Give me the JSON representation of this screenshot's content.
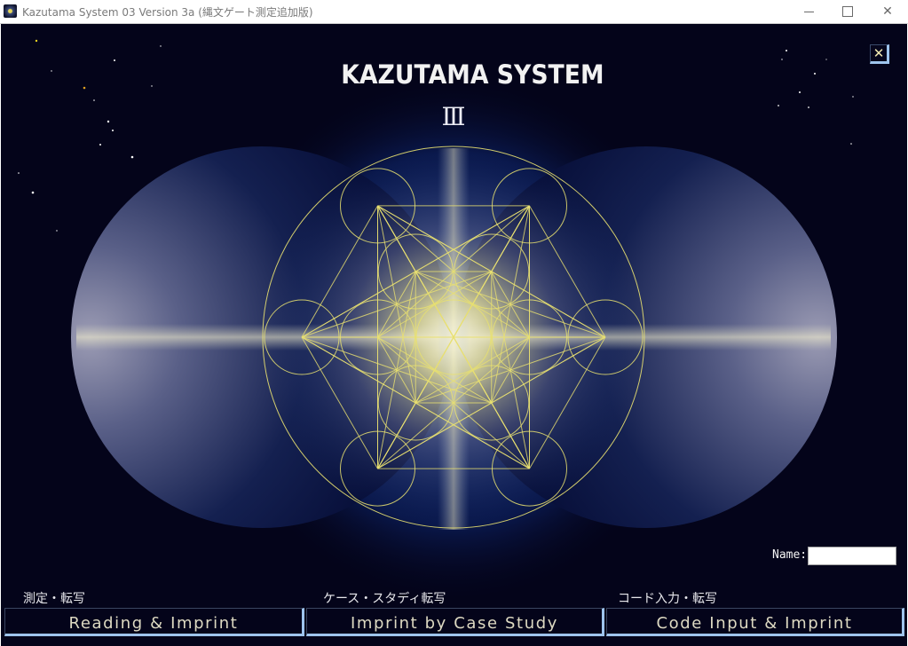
{
  "window": {
    "title": "Kazutama System 03 Version 3a (縄文ゲート測定追加版)",
    "controls": {
      "minimize": "minimize",
      "maximize": "maximize",
      "close": "✕"
    }
  },
  "header": {
    "logo_text": "KAZUTAMA SYSTEM",
    "subtitle": "Ⅲ"
  },
  "close_button": {
    "label": "✕"
  },
  "name_field": {
    "label": "Name:",
    "value": "",
    "placeholder": ""
  },
  "actions": [
    {
      "section_label": "測定・転写",
      "button_label": "Reading  &  Imprint"
    },
    {
      "section_label": "ケース・スタディ転写",
      "button_label": "Imprint  by  Case Study"
    },
    {
      "section_label": "コード入力・転写",
      "button_label": "Code Input  &  Imprint"
    }
  ],
  "artwork": {
    "name": "metatrons-cube",
    "line_color": "#e8e070",
    "background_color": "#04041a",
    "glow_color": "#fff8c0"
  }
}
